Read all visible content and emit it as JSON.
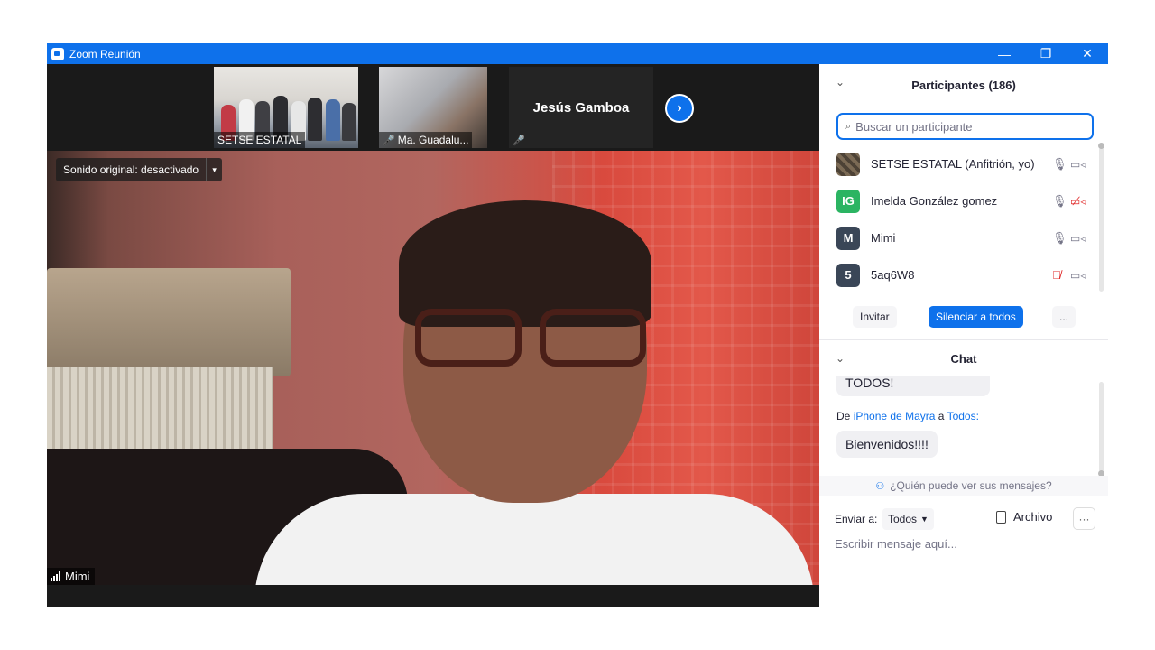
{
  "window": {
    "title": "Zoom Reunión",
    "controls": {
      "minimize": "—",
      "restore": "❐",
      "close": "✕"
    }
  },
  "thumbnails": [
    {
      "label": "SETSE ESTATAL",
      "muted": false
    },
    {
      "label": "Ma. Guadalu...",
      "muted": true
    },
    {
      "label": "Jesús Gamboa",
      "muted": true
    }
  ],
  "icons": {
    "mic_muted": "🎤",
    "next": "›",
    "search": "🔍",
    "mic": "🎙",
    "cam": "▭",
    "person": "👤",
    "chevron": "⌄"
  },
  "main_video": {
    "sound_label": "Sonido original: desactivado",
    "sound_caret": "▾",
    "speaker_name": "Mimi"
  },
  "participants": {
    "title": "Participantes (186)",
    "search_placeholder": "Buscar un participante",
    "list": [
      {
        "name": "SETSE ESTATAL (Anfitrión, yo)",
        "initials": "",
        "color": "#6b5a48",
        "mic_muted": false,
        "cam_off": false
      },
      {
        "name": "Imelda González gomez",
        "initials": "IG",
        "color": "#2bb462",
        "mic_muted": false,
        "cam_off": true
      },
      {
        "name": "Mimi",
        "initials": "M",
        "color": "#3a4657",
        "mic_muted": false,
        "cam_off": false
      },
      {
        "name": "5aq6W8",
        "initials": "5",
        "color": "#3a4657",
        "mic_muted": true,
        "cam_off": false
      }
    ],
    "invite_label": "Invitar",
    "mute_all_label": "Silenciar a todos",
    "more_label": "..."
  },
  "chat": {
    "title": "Chat",
    "prev_message": "TODOS!",
    "from_prefix": "De",
    "from_sender": "iPhone de Mayra",
    "from_mid": "a",
    "from_target": "Todos:",
    "message": "Bienvenidos!!!!",
    "who_sees": "¿Quién puede ver sus mensajes?",
    "send_to_label": "Enviar a:",
    "send_to_value": "Todos",
    "file_label": "Archivo",
    "more_label": "···",
    "input_placeholder": "Escribir mensaje aquí..."
  },
  "colors": {
    "accent": "#0e71eb",
    "muted": "#e02828"
  }
}
